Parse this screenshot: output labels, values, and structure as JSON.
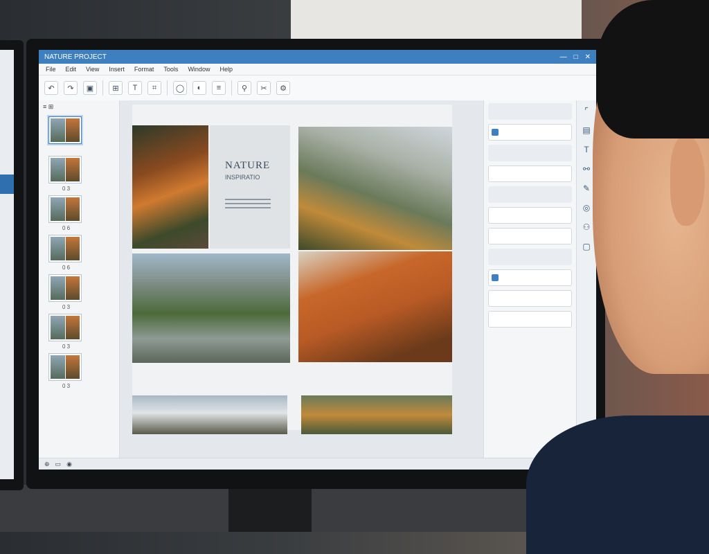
{
  "app": {
    "window_title": "NATURE PROJECT",
    "window_controls": [
      "—",
      "□",
      "✕"
    ]
  },
  "menu": [
    "File",
    "Edit",
    "View",
    "Insert",
    "Format",
    "Tools",
    "Window",
    "Help"
  ],
  "toolbar_icons": [
    "undo-icon",
    "redo-icon",
    "image-icon",
    "grid-icon",
    "text-icon",
    "crop-icon",
    "shape-icon",
    "color-icon",
    "align-icon",
    "settings-icon"
  ],
  "thumbnails": {
    "header": "≡ ⊞",
    "pages": [
      "",
      "0 3",
      "0 6",
      "0 6",
      "0 3",
      "0 3",
      "0 3"
    ]
  },
  "card": {
    "title": "NATURE",
    "subtitle": "INSPIRATIO"
  },
  "panel": {
    "rows": [
      "",
      "",
      "",
      "",
      "",
      "",
      "",
      "",
      "",
      "",
      ""
    ]
  },
  "side_icons": [
    "frame-icon",
    "layers-icon",
    "text-icon",
    "link-icon",
    "pen-icon",
    "user-icon",
    "person-icon",
    "lock-icon"
  ]
}
